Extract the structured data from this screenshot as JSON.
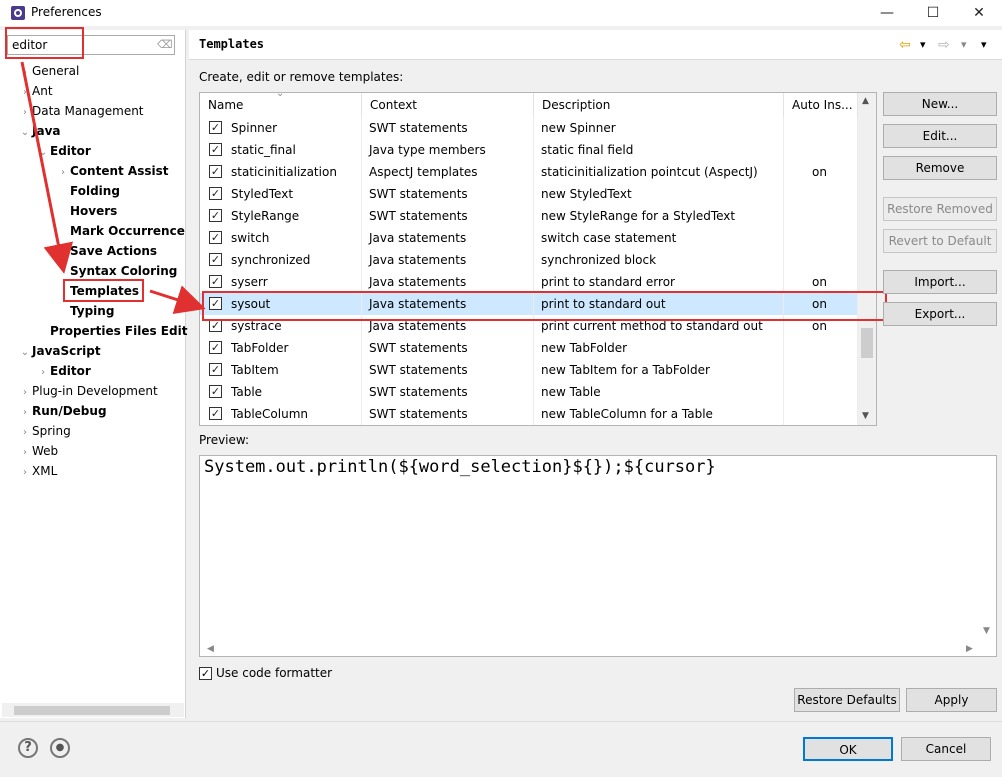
{
  "window": {
    "title": "Preferences",
    "min": "—",
    "max": "☐",
    "close": "✕"
  },
  "filter": {
    "value": "editor",
    "clear_glyph": "⌫"
  },
  "tree": [
    {
      "label": "General",
      "twisty": "›",
      "depth": 0,
      "bold": false
    },
    {
      "label": "Ant",
      "twisty": "›",
      "depth": 0,
      "bold": false
    },
    {
      "label": "Data Management",
      "twisty": "›",
      "depth": 0,
      "bold": false
    },
    {
      "label": "Java",
      "twisty": "⌄",
      "depth": 0,
      "bold": true
    },
    {
      "label": "Editor",
      "twisty": "⌄",
      "depth": 1,
      "bold": true
    },
    {
      "label": "Content Assist",
      "twisty": "›",
      "depth": 2,
      "bold": true
    },
    {
      "label": "Folding",
      "twisty": "",
      "depth": 2,
      "bold": true
    },
    {
      "label": "Hovers",
      "twisty": "",
      "depth": 2,
      "bold": true
    },
    {
      "label": "Mark Occurrence",
      "twisty": "",
      "depth": 2,
      "bold": true
    },
    {
      "label": "Save Actions",
      "twisty": "",
      "depth": 2,
      "bold": true
    },
    {
      "label": "Syntax Coloring",
      "twisty": "",
      "depth": 2,
      "bold": true
    },
    {
      "label": "Templates",
      "twisty": "",
      "depth": 2,
      "bold": true
    },
    {
      "label": "Typing",
      "twisty": "",
      "depth": 2,
      "bold": true
    },
    {
      "label": "Properties Files Edit",
      "twisty": "",
      "depth": 1,
      "bold": true
    },
    {
      "label": "JavaScript",
      "twisty": "⌄",
      "depth": 0,
      "bold": true
    },
    {
      "label": "Editor",
      "twisty": "›",
      "depth": 1,
      "bold": true
    },
    {
      "label": "Plug-in Development",
      "twisty": "›",
      "depth": 0,
      "bold": false
    },
    {
      "label": "Run/Debug",
      "twisty": "›",
      "depth": 0,
      "bold": true
    },
    {
      "label": "Spring",
      "twisty": "›",
      "depth": 0,
      "bold": false
    },
    {
      "label": "Web",
      "twisty": "›",
      "depth": 0,
      "bold": false
    },
    {
      "label": "XML",
      "twisty": "›",
      "depth": 0,
      "bold": false
    }
  ],
  "page": {
    "title": "Templates",
    "description": "Create, edit or remove templates:",
    "nav_back": "⇦",
    "nav_forward": "⇨",
    "dropdown": "▾",
    "menu": "▾"
  },
  "table": {
    "columns": [
      "Name",
      "Context",
      "Description",
      "Auto Ins..."
    ],
    "sort_glyph": "⌄",
    "rows": [
      {
        "name": "Spinner",
        "context": "SWT statements",
        "description": "new Spinner",
        "auto": ""
      },
      {
        "name": "static_final",
        "context": "Java type members",
        "description": "static final field",
        "auto": ""
      },
      {
        "name": "staticinitialization",
        "context": "AspectJ templates",
        "description": "staticinitialization pointcut (AspectJ)",
        "auto": "on"
      },
      {
        "name": "StyledText",
        "context": "SWT statements",
        "description": "new StyledText",
        "auto": ""
      },
      {
        "name": "StyleRange",
        "context": "SWT statements",
        "description": "new StyleRange for a StyledText",
        "auto": ""
      },
      {
        "name": "switch",
        "context": "Java statements",
        "description": "switch case statement",
        "auto": ""
      },
      {
        "name": "synchronized",
        "context": "Java statements",
        "description": "synchronized block",
        "auto": ""
      },
      {
        "name": "syserr",
        "context": "Java statements",
        "description": "print to standard error",
        "auto": "on"
      },
      {
        "name": "sysout",
        "context": "Java statements",
        "description": "print to standard out",
        "auto": "on"
      },
      {
        "name": "systrace",
        "context": "Java statements",
        "description": "print current method to standard out",
        "auto": "on"
      },
      {
        "name": "TabFolder",
        "context": "SWT statements",
        "description": "new TabFolder",
        "auto": ""
      },
      {
        "name": "TabItem",
        "context": "SWT statements",
        "description": "new TabItem for a TabFolder",
        "auto": ""
      },
      {
        "name": "Table",
        "context": "SWT statements",
        "description": "new Table",
        "auto": ""
      },
      {
        "name": "TableColumn",
        "context": "SWT statements",
        "description": "new TableColumn for a Table",
        "auto": ""
      }
    ],
    "selected_row": "sysout",
    "check_glyph": "✓"
  },
  "buttons": {
    "new": "New...",
    "edit": "Edit...",
    "remove": "Remove",
    "restore_removed": "Restore Removed",
    "revert_default": "Revert to Default",
    "import": "Import...",
    "export": "Export..."
  },
  "preview": {
    "label": "Preview:",
    "code": "System.out.println(${word_selection}${});${cursor}"
  },
  "formatter": {
    "label": "Use code formatter",
    "checked": "✓"
  },
  "footer": {
    "restore_defaults": "Restore Defaults",
    "apply": "Apply",
    "ok": "OK",
    "cancel": "Cancel",
    "help_glyph": "?",
    "record_glyph": "●"
  },
  "colors": {
    "selection": "#cde8ff",
    "annotation": "#e03030",
    "nav_arrow": "#e0a000"
  }
}
